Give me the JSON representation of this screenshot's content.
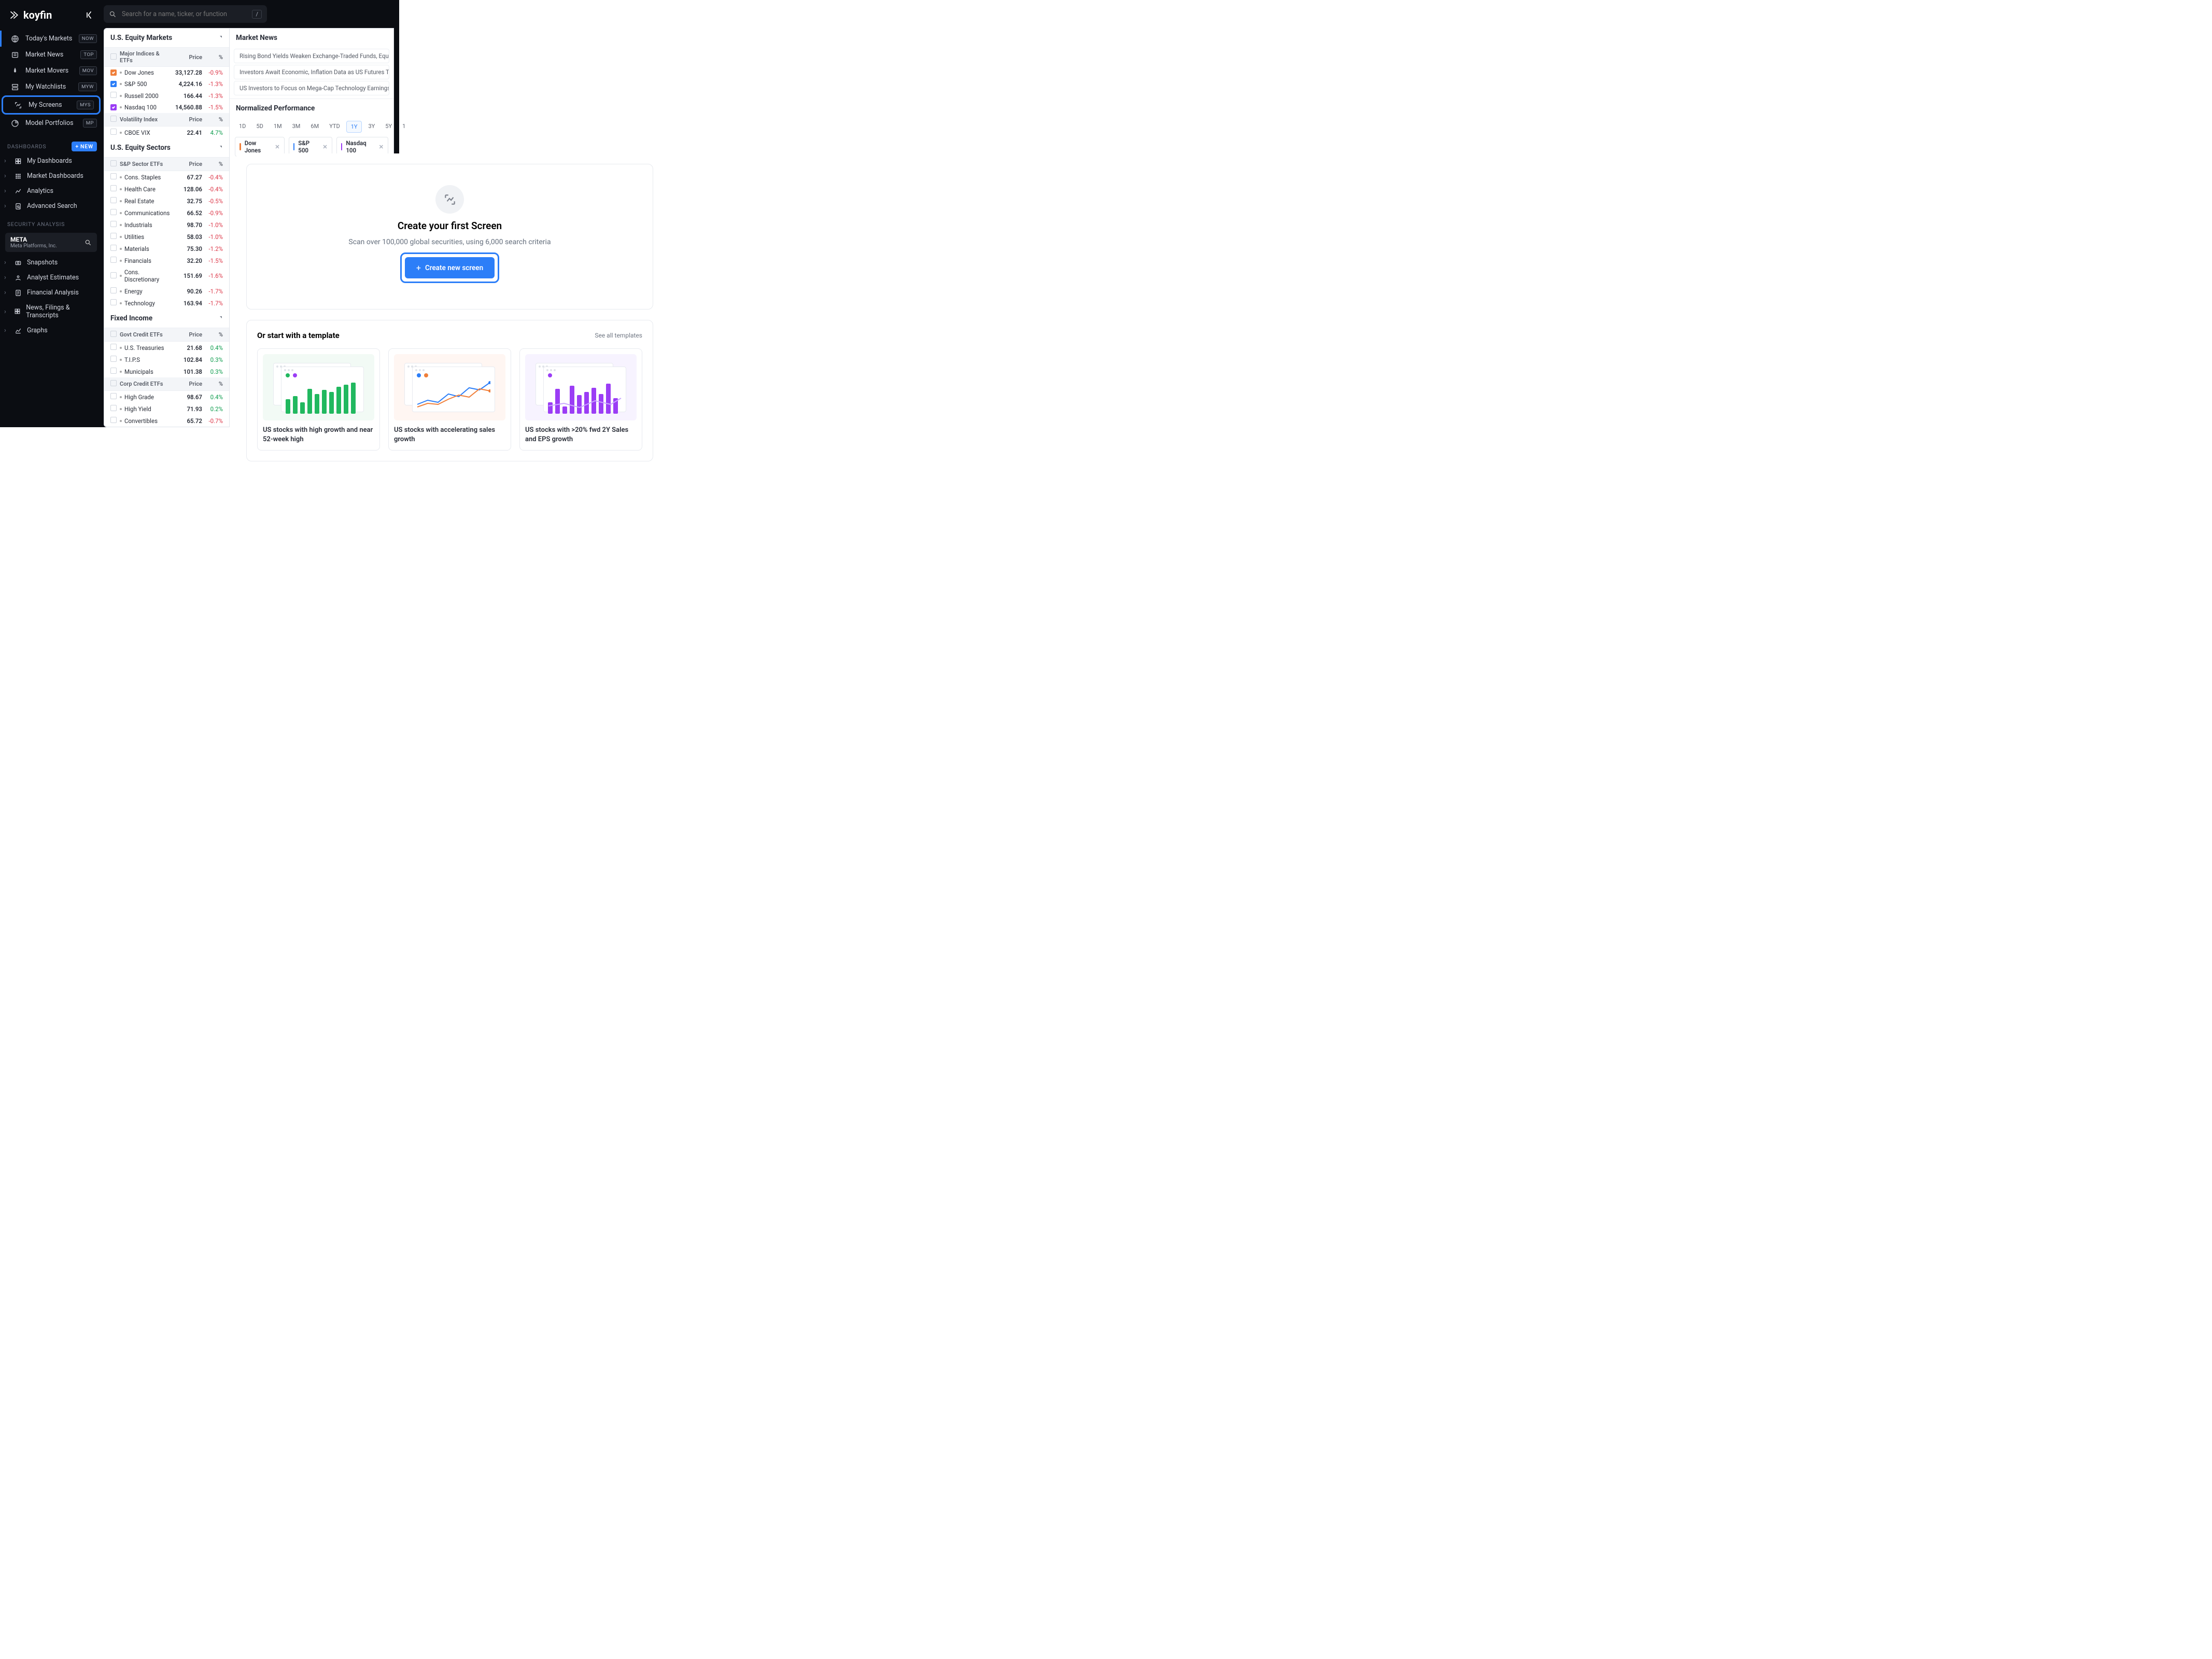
{
  "brand": "koyfin",
  "search": {
    "placeholder": "Search for a name, ticker, or function",
    "shortcut": "/"
  },
  "nav": {
    "items": [
      {
        "label": "Today's Markets",
        "badge": "NOW"
      },
      {
        "label": "Market News",
        "badge": "TOP"
      },
      {
        "label": "Market Movers",
        "badge": "MOV"
      },
      {
        "label": "My Watchlists",
        "badge": "MYW"
      },
      {
        "label": "My Screens",
        "badge": "MYS"
      },
      {
        "label": "Model Portfolios",
        "badge": "MP"
      }
    ],
    "dashboards_label": "DASHBOARDS",
    "new_label": "NEW",
    "dash_items": [
      {
        "label": "My Dashboards"
      },
      {
        "label": "Market Dashboards"
      },
      {
        "label": "Analytics"
      },
      {
        "label": "Advanced Search"
      }
    ],
    "sec_label": "SECURITY ANALYSIS",
    "security": {
      "ticker": "META",
      "name": "Meta Platforms, Inc."
    },
    "sec_items": [
      {
        "label": "Snapshots"
      },
      {
        "label": "Analyst Estimates"
      },
      {
        "label": "Financial Analysis"
      },
      {
        "label": "News, Filings & Transcripts"
      },
      {
        "label": "Graphs"
      }
    ]
  },
  "equity": {
    "title": "U.S. Equity Markets",
    "head": {
      "name": "Major Indices & ETFs",
      "price": "Price",
      "pct": "%"
    },
    "rows": [
      {
        "name": "Dow Jones",
        "price": "33,127.28",
        "pct": "-0.9%",
        "cls": "neg",
        "chk": "ck-orange"
      },
      {
        "name": "S&P 500",
        "price": "4,224.16",
        "pct": "-1.3%",
        "cls": "neg",
        "chk": "ck-blue"
      },
      {
        "name": "Russell 2000",
        "price": "166.44",
        "pct": "-1.3%",
        "cls": "neg",
        "chk": ""
      },
      {
        "name": "Nasdaq 100",
        "price": "14,560.88",
        "pct": "-1.5%",
        "cls": "neg",
        "chk": "ck-purple"
      }
    ],
    "head2": {
      "name": "Volatility Index",
      "price": "Price",
      "pct": "%"
    },
    "rows2": [
      {
        "name": "CBOE VIX",
        "price": "22.41",
        "pct": "4.7%",
        "cls": "pos"
      }
    ]
  },
  "sectors": {
    "title": "U.S. Equity Sectors",
    "head": {
      "name": "S&P Sector ETFs",
      "price": "Price",
      "pct": "%"
    },
    "rows": [
      {
        "name": "Cons. Staples",
        "price": "67.27",
        "pct": "-0.4%",
        "cls": "neg"
      },
      {
        "name": "Health Care",
        "price": "128.06",
        "pct": "-0.4%",
        "cls": "neg"
      },
      {
        "name": "Real Estate",
        "price": "32.75",
        "pct": "-0.5%",
        "cls": "neg"
      },
      {
        "name": "Communications",
        "price": "66.52",
        "pct": "-0.9%",
        "cls": "neg"
      },
      {
        "name": "Industrials",
        "price": "98.70",
        "pct": "-1.0%",
        "cls": "neg"
      },
      {
        "name": "Utilities",
        "price": "58.03",
        "pct": "-1.0%",
        "cls": "neg"
      },
      {
        "name": "Materials",
        "price": "75.30",
        "pct": "-1.2%",
        "cls": "neg"
      },
      {
        "name": "Financials",
        "price": "32.20",
        "pct": "-1.5%",
        "cls": "neg"
      },
      {
        "name": "Cons. Discretionary",
        "price": "151.69",
        "pct": "-1.6%",
        "cls": "neg"
      },
      {
        "name": "Energy",
        "price": "90.26",
        "pct": "-1.7%",
        "cls": "neg"
      },
      {
        "name": "Technology",
        "price": "163.94",
        "pct": "-1.7%",
        "cls": "neg"
      }
    ]
  },
  "fixed": {
    "title": "Fixed Income",
    "head": {
      "name": "Govt Credit ETFs",
      "price": "Price",
      "pct": "%"
    },
    "rows": [
      {
        "name": "U.S. Treasuries",
        "price": "21.68",
        "pct": "0.4%",
        "cls": "pos"
      },
      {
        "name": "T.I.P.S",
        "price": "102.84",
        "pct": "0.3%",
        "cls": "pos"
      },
      {
        "name": "Municipals",
        "price": "101.38",
        "pct": "0.3%",
        "cls": "pos"
      }
    ],
    "head2": {
      "name": "Corp Credit ETFs",
      "price": "Price",
      "pct": "%"
    },
    "rows2": [
      {
        "name": "High Grade",
        "price": "98.67",
        "pct": "0.4%",
        "cls": "pos"
      },
      {
        "name": "High Yield",
        "price": "71.93",
        "pct": "0.2%",
        "cls": "pos"
      },
      {
        "name": "Convertibles",
        "price": "65.72",
        "pct": "-0.7%",
        "cls": "neg"
      }
    ]
  },
  "news": {
    "title": "Market News",
    "items": [
      "Rising Bond Yields Weaken Exchange-Traded Funds, Equity",
      "Investors Await Economic, Inflation Data as US Futures Tre",
      "US Investors to Focus on Mega-Cap Technology Earnings,"
    ]
  },
  "perf": {
    "title": "Normalized Performance",
    "ranges": [
      "1D",
      "5D",
      "1M",
      "3M",
      "6M",
      "YTD",
      "1Y",
      "3Y",
      "5Y",
      "1"
    ],
    "active": "1Y",
    "chips": [
      {
        "label": "Dow Jones",
        "color": "#f07f3a"
      },
      {
        "label": "S&P 500",
        "color": "#2c7ef8"
      },
      {
        "label": "Nasdaq 100",
        "color": "#9b3df5"
      }
    ]
  },
  "overlay": {
    "title": "Create your first Screen",
    "subtitle": "Scan over 100,000 global securities, using 6,000 search criteria",
    "cta": "Create new screen",
    "tpl_title": "Or start with a template",
    "see_all": "See all templates",
    "cards": [
      {
        "label": "US stocks with high growth and near 52-week high"
      },
      {
        "label": "US stocks with accelerating sales growth"
      },
      {
        "label": "US stocks with >20% fwd 2Y Sales and EPS growth"
      }
    ]
  }
}
